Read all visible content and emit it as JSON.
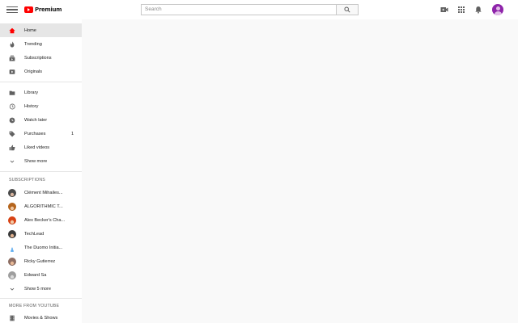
{
  "header": {
    "logo_text": "Premium",
    "search_placeholder": "Search",
    "icons": [
      "menu-icon",
      "search-icon",
      "video-camera-icon",
      "apps-grid-icon",
      "notifications-bell-icon",
      "account-avatar"
    ]
  },
  "sidebar": {
    "primary": [
      {
        "label": "Home",
        "icon": "home-icon",
        "active": true
      },
      {
        "label": "Trending",
        "icon": "flame-icon"
      },
      {
        "label": "Subscriptions",
        "icon": "subscriptions-icon"
      },
      {
        "label": "Originals",
        "icon": "originals-icon"
      }
    ],
    "library": [
      {
        "label": "Library",
        "icon": "folder-icon"
      },
      {
        "label": "History",
        "icon": "history-icon"
      },
      {
        "label": "Watch later",
        "icon": "clock-icon"
      },
      {
        "label": "Purchases",
        "icon": "tag-icon",
        "count": "1"
      },
      {
        "label": "Liked videos",
        "icon": "thumbs-up-icon"
      },
      {
        "label": "Show more",
        "icon": "chevron-down-icon"
      }
    ],
    "subscriptions_title": "SUBSCRIPTIONS",
    "subscriptions": [
      {
        "label": "Clément Mihailes...",
        "color": "#4a4a4a"
      },
      {
        "label": "ALGORITHMIC T...",
        "color": "#b5651d"
      },
      {
        "label": "Alex Becker's Cha...",
        "color": "#d84315"
      },
      {
        "label": "TechLead",
        "color": "#3a3a3a"
      },
      {
        "label": "The Duomo Initia...",
        "color": "#1e88e5"
      },
      {
        "label": "Ricky Gutierrez",
        "color": "#8d6e63"
      },
      {
        "label": "Edward Sa",
        "color": "#9e9e9e"
      }
    ],
    "show_more_subs": "Show 5 more",
    "more_title": "MORE FROM YOUTUBE",
    "more": [
      {
        "label": "Movies & Shows",
        "icon": "film-icon"
      }
    ]
  },
  "colors": {
    "brand_red": "#ff0000",
    "active_bg": "#e6e6e6",
    "page_bg": "#f9f9f9"
  }
}
